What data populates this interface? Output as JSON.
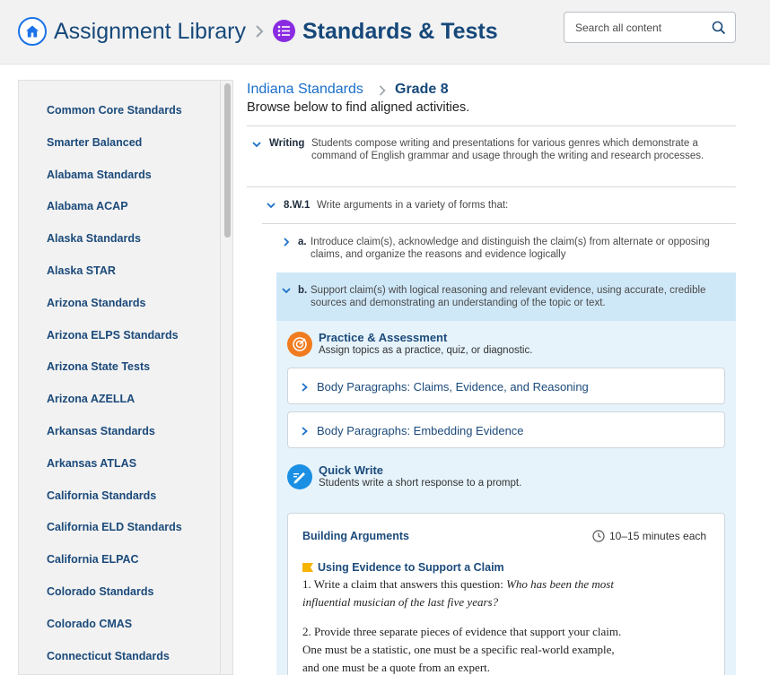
{
  "header": {
    "library_title": "Assignment Library",
    "section_title": "Standards & Tests",
    "search_placeholder": "Search all content",
    "colors": {
      "header_bg": "#f2f2f2",
      "title": "#16487a",
      "home_icon": "#1a73e8",
      "section_icon": "#8a2be2"
    }
  },
  "sidebar": {
    "items": [
      "Common Core Standards",
      "Smarter Balanced",
      "Alabama Standards",
      "Alabama ACAP",
      "Alaska Standards",
      "Alaska STAR",
      "Arizona Standards",
      "Arizona ELPS Standards",
      "Arizona State Tests",
      "Arizona AZELLA",
      "Arkansas Standards",
      "Arkansas ATLAS",
      "California Standards",
      "California ELD Standards",
      "California ELPAC",
      "Colorado Standards",
      "Colorado CMAS",
      "Connecticut Standards"
    ]
  },
  "main": {
    "breadcrumb": {
      "standards": "Indiana Standards",
      "grade": "Grade 8"
    },
    "subtitle": "Browse below to find aligned activities.",
    "writing": {
      "label": "Writing",
      "text": "Students compose writing and presentations for various genres which demonstrate a command of English grammar and usage through the writing and research processes."
    },
    "standard_w1": {
      "code": "8.W.1",
      "text": "Write arguments in a variety of forms that:"
    },
    "sub_a": {
      "letter": "a.",
      "text": "Introduce claim(s), acknowledge and distinguish the claim(s) from alternate or opposing claims, and organize the reasons and evidence logically"
    },
    "sub_b": {
      "letter": "b.",
      "text": "Support claim(s) with logical reasoning and relevant evidence, using accurate, credible sources and demonstrating an understanding of the topic or text."
    },
    "practice": {
      "title": "Practice & Assessment",
      "desc": "Assign topics as a practice, quiz, or diagnostic.",
      "topics": [
        "Body Paragraphs: Claims, Evidence, and Reasoning",
        "Body Paragraphs: Embedding Evidence"
      ]
    },
    "quick_write": {
      "title": "Quick Write",
      "desc": "Students write a short response to a prompt.",
      "card_title": "Building Arguments",
      "time": "10–15 minutes each",
      "prompt_title": "Using Evidence to Support a Claim",
      "prompt_1_lead": "1. Write a claim that answers this question: ",
      "prompt_1_question": "Who has been the most influential musician of the last five years?",
      "prompt_2": "2. Provide three separate pieces of evidence that support your claim. One must be a statistic, one must be a specific real-world example, and one must be a quote from an expert."
    }
  }
}
